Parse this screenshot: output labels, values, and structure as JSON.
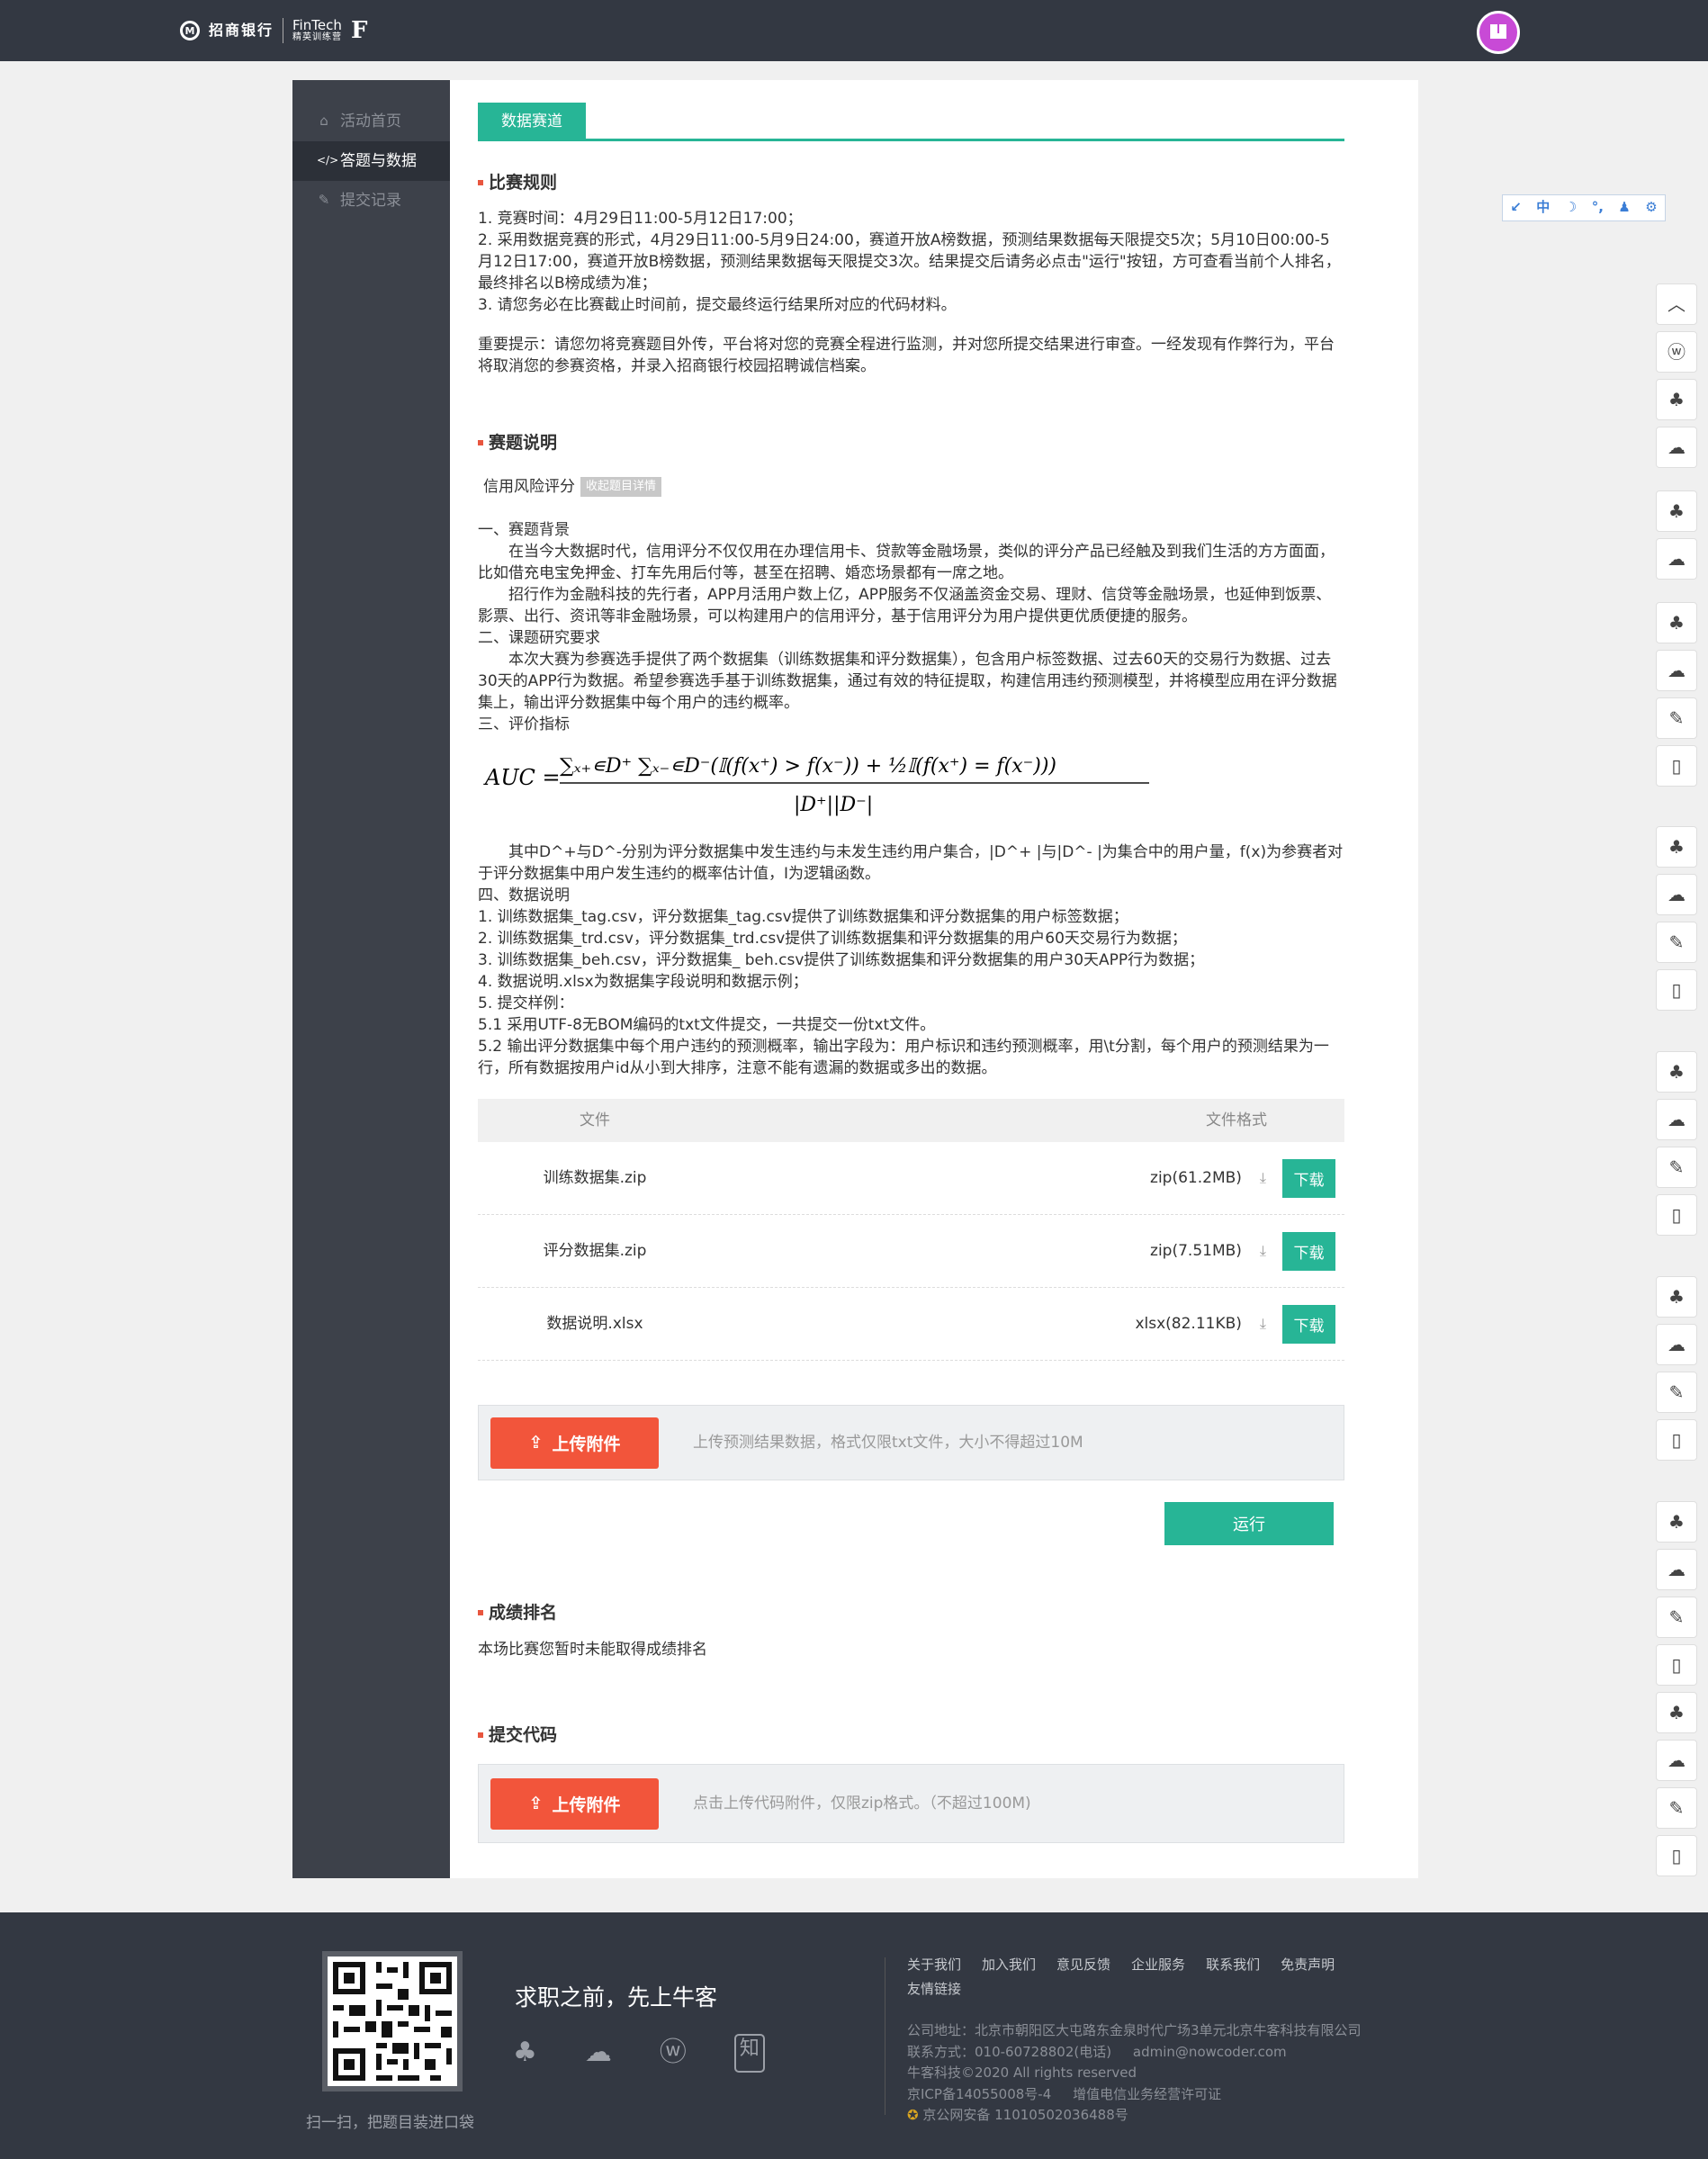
{
  "header": {
    "bank_name": "招商银行",
    "fintech_title": "FinTech",
    "fintech_sub": "精英训练营",
    "logo_mark": "F"
  },
  "sidebar": {
    "items": [
      {
        "label": "活动首页",
        "icon": "home-icon",
        "glyph": "⌂"
      },
      {
        "label": "答题与数据",
        "icon": "code-icon",
        "glyph": "</>"
      },
      {
        "label": "提交记录",
        "icon": "edit-icon",
        "glyph": "✎"
      }
    ]
  },
  "tab": "数据赛道",
  "rules": {
    "title": "比赛规则",
    "lines": [
      "1. 竞赛时间：4月29日11:00-5月12日17:00；",
      "2. 采用数据竞赛的形式，4月29日11:00-5月9日24:00，赛道开放A榜数据，预测结果数据每天限提交5次；5月10日00:00-5月12日17:00，赛道开放B榜数据，预测结果数据每天限提交3次。结果提交后请务必点击\"运行\"按钮，方可查看当前个人排名，最终排名以B榜成绩为准；",
      "3. 请您务必在比赛截止时间前，提交最终运行结果所对应的代码材料。"
    ],
    "notice": "重要提示：请您勿将竞赛题目外传，平台将对您的竞赛全程进行监测，并对您所提交结果进行审查。一经发现有作弊行为，平台将取消您的参赛资格，并录入招商银行校园招聘诚信档案。"
  },
  "desc": {
    "title": "赛题说明",
    "topic": "信用风险评分",
    "collapse_label": "收起题目详情",
    "h1": "一、赛题背景",
    "p1": "在当今大数据时代，信用评分不仅仅用在办理信用卡、贷款等金融场景，类似的评分产品已经触及到我们生活的方方面面，比如借充电宝免押金、打车先用后付等，甚至在招聘、婚恋场景都有一席之地。",
    "p2": "招行作为金融科技的先行者，APP月活用户数上亿，APP服务不仅涵盖资金交易、理财、信贷等金融场景，也延伸到饭票、影票、出行、资讯等非金融场景，可以构建用户的信用评分，基于信用评分为用户提供更优质便捷的服务。",
    "h2": "二、课题研究要求",
    "p3": "本次大赛为参赛选手提供了两个数据集（训练数据集和评分数据集），包含用户标签数据、过去60天的交易行为数据、过去30天的APP行为数据。希望参赛选手基于训练数据集，通过有效的特征提取，构建信用违约预测模型，并将模型应用在评分数据集上，输出评分数据集中每个用户的违约概率。",
    "h3": "三、评价指标",
    "p4": "其中D^+与D^-分别为评分数据集中发生违约与未发生违约用户集合，|D^+ |与|D^- |为集合中的用户量，f(x)为参赛者对于评分数据集中用户发生违约的概率估计值，I为逻辑函数。",
    "h4": "四、数据说明",
    "data_lines": [
      "1. 训练数据集_tag.csv，评分数据集_tag.csv提供了训练数据集和评分数据集的用户标签数据；",
      "2. 训练数据集_trd.csv，评分数据集_trd.csv提供了训练数据集和评分数据集的用户60天交易行为数据；",
      "3. 训练数据集_beh.csv，评分数据集_ beh.csv提供了训练数据集和评分数据集的用户30天APP行为数据；",
      "4. 数据说明.xlsx为数据集字段说明和数据示例；"
    ],
    "h5": "5. 提交样例：",
    "sample_lines": [
      "5.1  采用UTF-8无BOM编码的txt文件提交，一共提交一份txt文件。",
      "5.2  输出评分数据集中每个用户违约的预测概率，输出字段为：用户标识和违约预测概率，用\\t分割，每个用户的预测结果为一行，所有数据按用户id从小到大排序，注意不能有遗漏的数据或多出的数据。"
    ]
  },
  "files": {
    "col_file": "文件",
    "col_format": "文件格式",
    "rows": [
      {
        "name": "训练数据集.zip",
        "size": "zip(61.2MB)",
        "button": "下载"
      },
      {
        "name": "评分数据集.zip",
        "size": "zip(7.51MB)",
        "button": "下载"
      },
      {
        "name": "数据说明.xlsx",
        "size": "xlsx(82.11KB)",
        "button": "下载"
      }
    ]
  },
  "upload_result": {
    "button": "上传附件",
    "hint": "上传预测结果数据，格式仅限txt文件，大小不得超过10M"
  },
  "run_button": "运行",
  "ranking": {
    "title": "成绩排名",
    "text": "本场比赛您暂时未能取得成绩排名"
  },
  "submit_code": {
    "title": "提交代码",
    "button": "上传附件",
    "hint": "点击上传代码附件，仅限zip格式。（不超过100M)"
  },
  "toolbar": {
    "items": [
      "↙",
      "中",
      "☽",
      "°,",
      "♟",
      "⚙"
    ]
  },
  "share_bar": {
    "glyphs": [
      "︿",
      "ⓦ",
      "♣",
      "☁",
      "♣",
      "☁",
      "♣",
      "☁",
      "✎",
      "▯",
      "♣",
      "☁",
      "✎",
      "▯",
      "♣",
      "☁",
      "✎",
      "▯",
      "♣",
      "☁",
      "✎",
      "▯",
      "♣",
      "☁",
      "✎",
      "▯",
      "♣",
      "☁",
      "✎",
      "▯"
    ]
  },
  "footer": {
    "qr_caption": "扫一扫，把题目装进口袋",
    "slogan": "求职之前，先上牛客",
    "links": [
      "关于我们",
      "加入我们",
      "意见反馈",
      "企业服务",
      "联系我们",
      "免责声明",
      "友情链接"
    ],
    "address": "公司地址：北京市朝阳区大屯路东金泉时代广场3单元北京牛客科技有限公司",
    "contact": "联系方式：010-60728802(电话)     admin@nowcoder.com",
    "copyright": "牛客科技©2020 All rights reserved",
    "icp": "京ICP备14055008号-4     增值电信业务经营许可证",
    "police": "京公网安备 11010502036488号"
  }
}
